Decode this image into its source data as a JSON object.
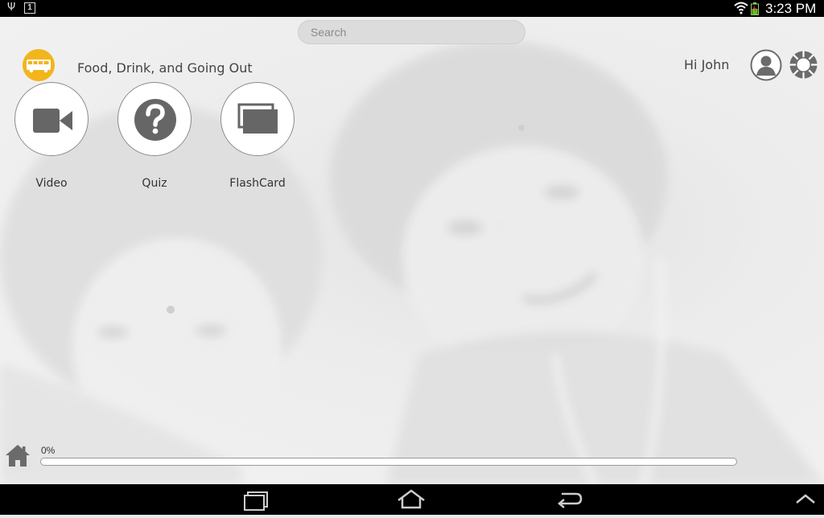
{
  "status_bar": {
    "notification_count": "1",
    "time": "3:23 PM",
    "icons": [
      "usb-icon",
      "notification-icon",
      "wifi-icon",
      "battery-icon"
    ]
  },
  "search": {
    "placeholder": "Search"
  },
  "header": {
    "category_title": "Food, Drink, and Going Out",
    "greeting": "Hi John",
    "logo_color": "#f2b51c"
  },
  "activities": [
    {
      "label": "Video",
      "icon": "video-camera-icon"
    },
    {
      "label": "Quiz",
      "icon": "question-icon"
    },
    {
      "label": "FlashCard",
      "icon": "flashcard-icon"
    }
  ],
  "progress": {
    "label": "0%",
    "value": 0
  },
  "nav_bar": {
    "icons": [
      "recent-apps-icon",
      "home-nav-icon",
      "back-icon",
      "up-chevron-icon"
    ]
  },
  "colors": {
    "accent": "#f2b51c",
    "icon_gray": "#666666",
    "status_bar": "#000000"
  }
}
